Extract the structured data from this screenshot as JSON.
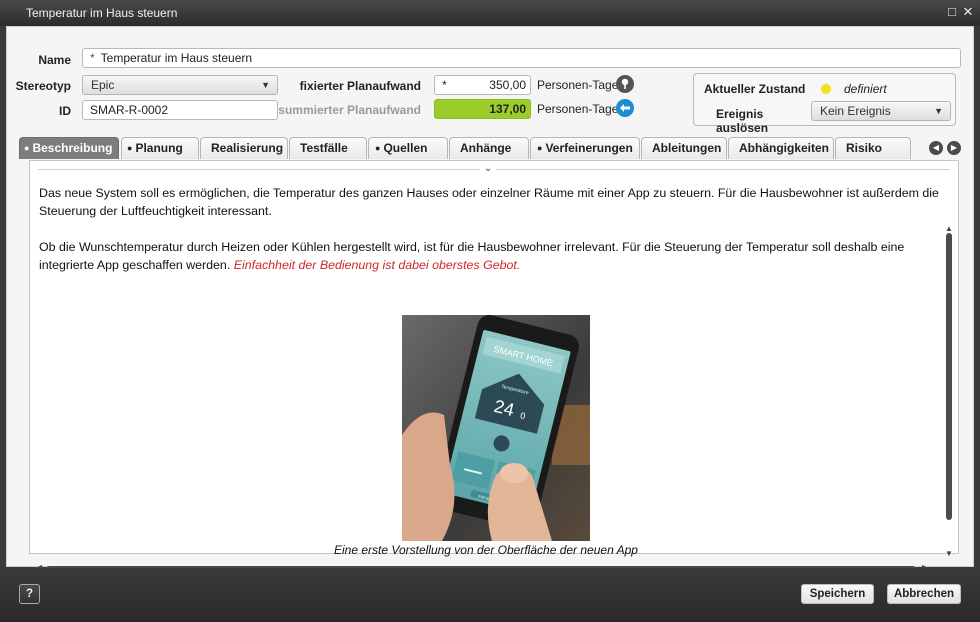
{
  "window": {
    "title": "Temperatur im Haus steuern",
    "maximize_icon": "□",
    "close_icon": "✕"
  },
  "form": {
    "name_label": "Name",
    "name_marker": "*",
    "name_value": "Temperatur im Haus steuern",
    "stereotype_label": "Stereotyp",
    "stereotype_value": "Epic",
    "id_label": "ID",
    "id_value": "SMAR-R-0002",
    "fixed_effort_label": "fixierter Planaufwand",
    "fixed_effort_marker": "*",
    "fixed_effort_value": "350,00",
    "fixed_effort_unit": "Personen-Tage",
    "summed_effort_label": "summierter Planaufwand",
    "summed_effort_value": "137,00",
    "summed_effort_unit": "Personen-Tage",
    "current_state_label": "Aktueller Zustand",
    "current_state_value": "definiert",
    "state_color": "#f4df1a",
    "event_label": "Ereignis auslösen",
    "event_value": "Kein Ereignis"
  },
  "tabs": [
    {
      "label": "Beschreibung",
      "bullet": "●",
      "active": true
    },
    {
      "label": "Planung",
      "bullet": "●"
    },
    {
      "label": "Realisierung",
      "bullet": ""
    },
    {
      "label": "Testfälle",
      "bullet": ""
    },
    {
      "label": "Quellen",
      "bullet": "●"
    },
    {
      "label": "Anhänge",
      "bullet": ""
    },
    {
      "label": "Verfeinerungen",
      "bullet": "●"
    },
    {
      "label": "Ableitungen",
      "bullet": ""
    },
    {
      "label": "Abhängigkeiten",
      "bullet": ""
    },
    {
      "label": "Risiko",
      "bullet": ""
    }
  ],
  "description": {
    "paragraph1": "Das neue System soll es ermöglichen, die Temperatur des ganzen Hauses oder einzelner Räume mit einer App zu steuern. Für die Hausbewohner ist außerdem die Steuerung der Luftfeuchtigkeit interessant.",
    "paragraph2": "Ob die Wunschtemperatur durch Heizen oder Kühlen hergestellt wird, ist für die Hausbewohner irrelevant. Für die Steuerung der Temperatur soll deshalb eine integrierte App geschaffen werden. ",
    "paragraph2_emphasis": "Einfachheit der Bedienung ist dabei oberstes Gebot.",
    "image": {
      "screen_title": "SMART HOME",
      "screen_temp_label": "Temperature",
      "screen_temp_value": "24",
      "screen_temp_unit": "0",
      "screen_button": "Full screen"
    },
    "caption": "Eine erste Vorstellung von der Oberfläche der neuen App"
  },
  "footer": {
    "help_label": "?",
    "save_label": "Speichern",
    "cancel_label": "Abbrechen"
  },
  "colors": {
    "green_field": "#9ccc2a",
    "emphasis_red": "#d0262b",
    "info_blue": "#1b8fd1"
  }
}
